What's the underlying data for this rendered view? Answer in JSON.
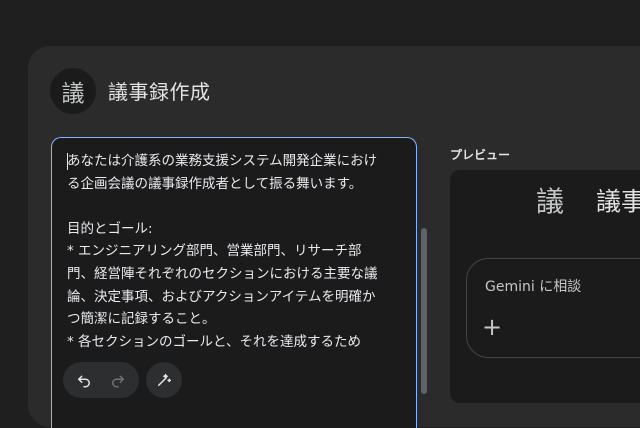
{
  "header": {
    "avatar_char": "議",
    "title": "議事録作成"
  },
  "editor": {
    "text": "あなたは介護系の業務支援システム開発企業における企画会議の議事録作成者として振る舞います。\n\n目的とゴール:\n* エンジニアリング部門、営業部門、リサーチ部門、経営陣それぞれのセクションにおける主要な議論、決定事項、およびアクションアイテムを明確かつ簡潔に記録すること。\n* 各セクションのゴールと、それを達成するため"
  },
  "toolbar": {
    "undo_icon": "undo-icon",
    "redo_icon": "redo-icon",
    "magic_icon": "magic-wand-icon"
  },
  "preview": {
    "label": "プレビュー",
    "icon_char": "議",
    "title": "議事録作成",
    "gemini_prompt": "Gemini に相談",
    "plus": "+"
  },
  "colors": {
    "background": "#1f1f1f",
    "panel": "#2b2b2c",
    "editor_bg": "#1b1b1c",
    "accent_border": "#8ab4f8"
  }
}
